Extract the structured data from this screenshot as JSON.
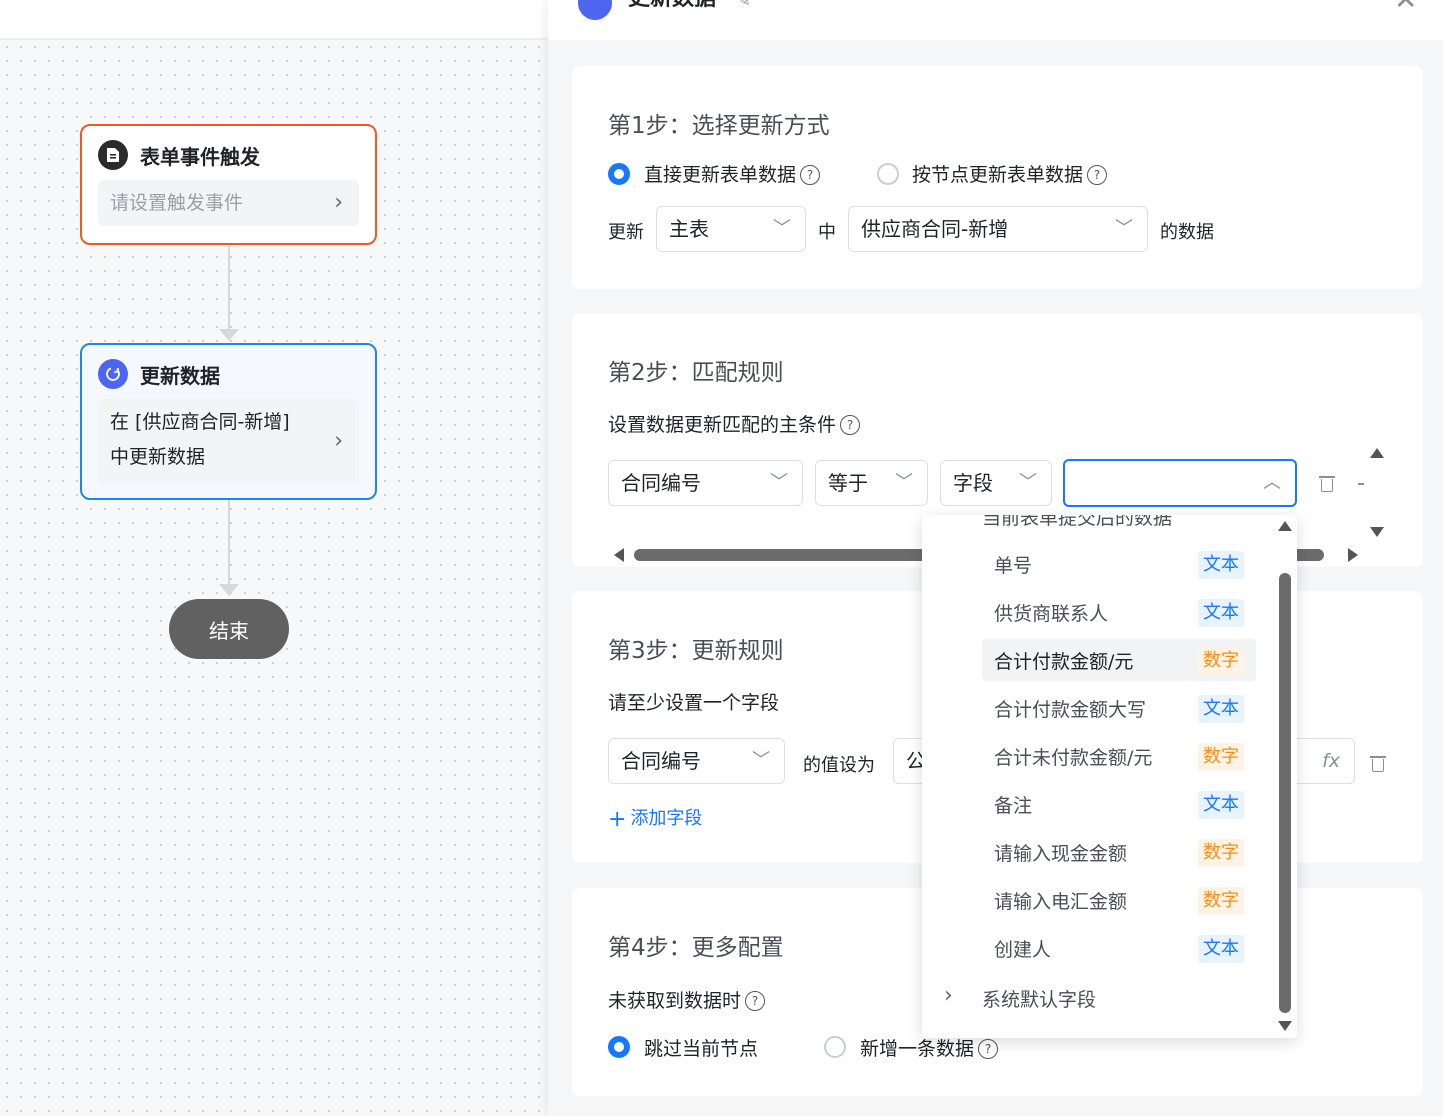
{
  "canvas": {
    "trigger_node": {
      "title": "表单事件触发",
      "body": "请设置触发事件"
    },
    "update_node": {
      "title": "更新数据",
      "body_line1": "在 [供应商合同-新增]",
      "body_line2": "中更新数据"
    },
    "end_node": {
      "label": "结束"
    }
  },
  "drawer": {
    "title": "更新数据",
    "step1": {
      "title": "第1步：选择更新方式",
      "option1": "直接更新表单数据",
      "option2": "按节点更新表单数据",
      "update_label": "更新",
      "table_select": "主表",
      "middle_label": "中",
      "form_select": "供应商合同-新增",
      "suffix_label": "的数据"
    },
    "step2": {
      "title": "第2步：匹配规则",
      "subtitle": "设置数据更新匹配的主条件",
      "field_select": "合同编号",
      "operator_select": "等于",
      "type_select": "字段",
      "value_select": ""
    },
    "step3": {
      "title": "第3步：更新规则",
      "subtitle": "请至少设置一个字段",
      "field_select": "合同编号",
      "value_label": "的值设为",
      "formula_partial": "公",
      "add_field": "添加字段",
      "fx": "fx"
    },
    "step4": {
      "title": "第4步：更多配置",
      "subtitle": "未获取到数据时",
      "option1": "跳过当前节点",
      "option2": "新增一条数据"
    }
  },
  "dropdown": {
    "group_expanded": "当前表单提交后的数据",
    "items": [
      {
        "label": "单号",
        "tag": "文本",
        "kind": "text"
      },
      {
        "label": "供货商联系人",
        "tag": "文本",
        "kind": "text"
      },
      {
        "label": "合计付款金额/元",
        "tag": "数字",
        "kind": "num"
      },
      {
        "label": "合计付款金额大写",
        "tag": "文本",
        "kind": "text"
      },
      {
        "label": "合计未付款金额/元",
        "tag": "数字",
        "kind": "num"
      },
      {
        "label": "备注",
        "tag": "文本",
        "kind": "text"
      },
      {
        "label": "请输入现金金额",
        "tag": "数字",
        "kind": "num"
      },
      {
        "label": "请输入电汇金额",
        "tag": "数字",
        "kind": "num"
      },
      {
        "label": "创建人",
        "tag": "文本",
        "kind": "text"
      }
    ],
    "group_collapsed": "系统默认字段"
  },
  "colors": {
    "primary": "#1677ff",
    "trigger_border": "#ee5a24",
    "update_border": "#1e88e5",
    "end_node": "#616161"
  }
}
